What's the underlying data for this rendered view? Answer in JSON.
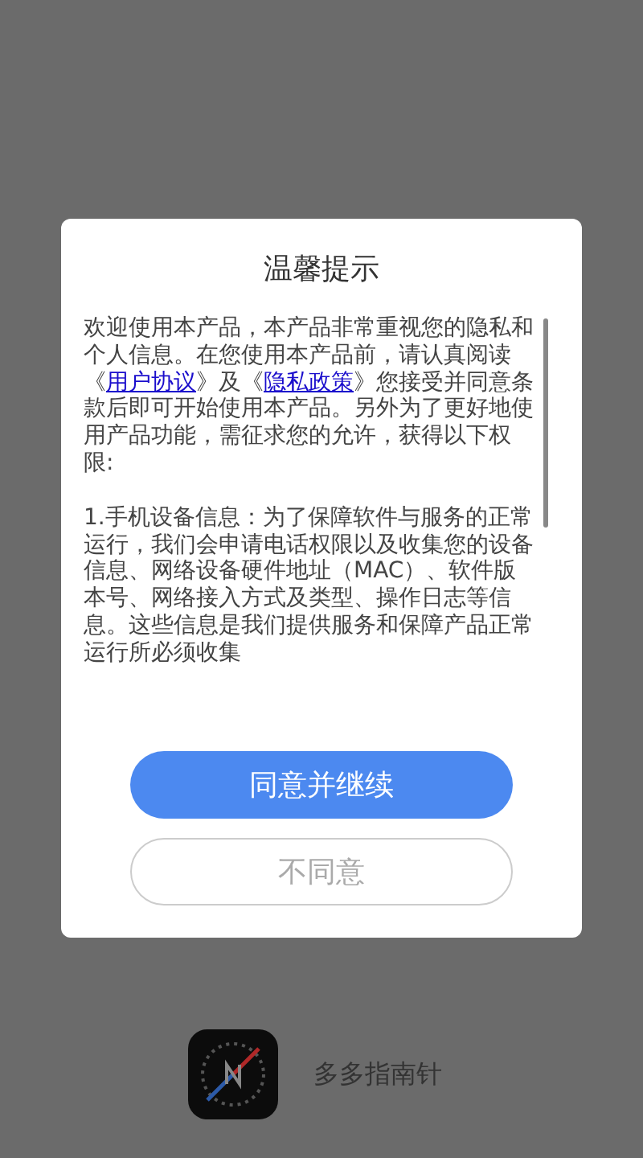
{
  "dialog": {
    "title": "温馨提示",
    "paragraphs": [
      {
        "segments": [
          {
            "kind": "text",
            "text": "欢迎使用本产品，本产品非常重视您的隐私和个人信息。在您使用本产品前，请认真阅读《"
          },
          {
            "kind": "link",
            "text": "用户协议"
          },
          {
            "kind": "text",
            "text": "》及《"
          },
          {
            "kind": "link",
            "text": "隐私政策"
          },
          {
            "kind": "text",
            "text": "》您接受并同意条款后即可开始使用本产品。另外为了更好地使用产品功能，需征求您的允许，获得以下权限:"
          }
        ]
      },
      {
        "segments": [
          {
            "kind": "text",
            "text": "1.手机设备信息：为了保障软件与服务的正常运行，我们会申请电话权限以及收集您的设备信息、网络设备硬件地址（MAC）、软件版本号、网络接入方式及类型、操作日志等信息。这些信息是我们提供服务和保障产品正常运行所必须收集"
          }
        ]
      }
    ],
    "buttons": [
      {
        "kind": "primary",
        "label": "同意并继续"
      },
      {
        "kind": "secondary",
        "label": "不同意"
      }
    ]
  },
  "app": {
    "name": "多多指南针"
  }
}
